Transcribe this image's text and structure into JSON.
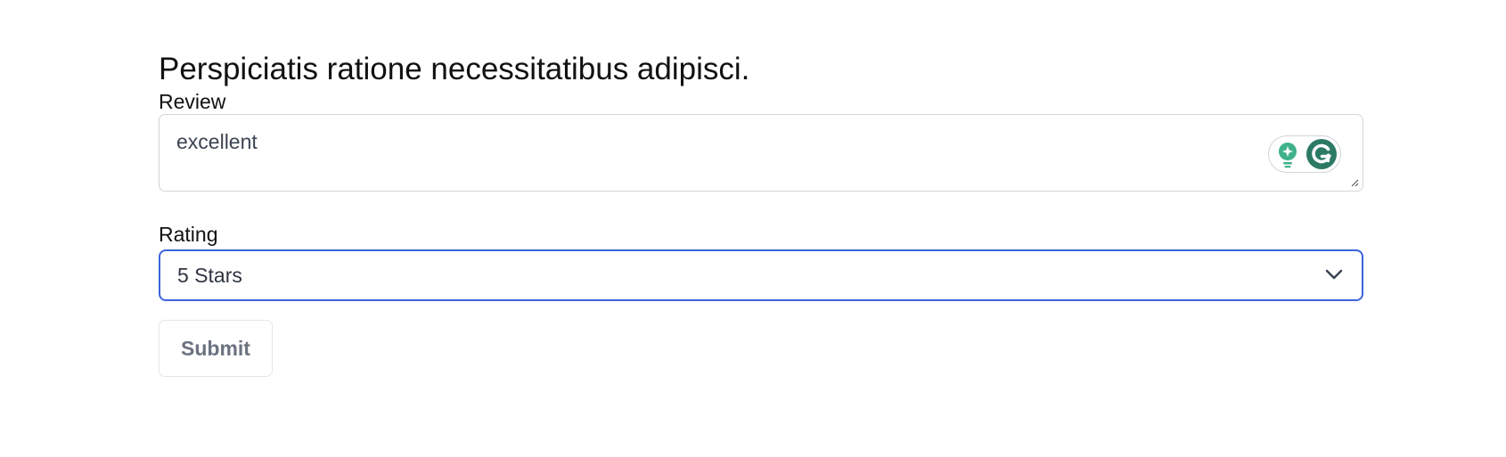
{
  "form": {
    "heading": "Perspiciatis ratione necessitatibus adipisci.",
    "review": {
      "label": "Review",
      "value": "excellent"
    },
    "rating": {
      "label": "Rating",
      "selected": "5 Stars"
    },
    "submit_label": "Submit"
  },
  "icons": {
    "grammarly_bulb": "lightbulb-icon",
    "grammarly_logo": "grammarly-g-icon",
    "select_chevron": "chevron-down-icon",
    "resize": "resize-handle-icon"
  },
  "colors": {
    "focus_border": "#3d63dd",
    "grammarly_green": "#2c7a64",
    "grammarly_bulb": "#3fb28c",
    "submit_text": "#6b7280"
  }
}
